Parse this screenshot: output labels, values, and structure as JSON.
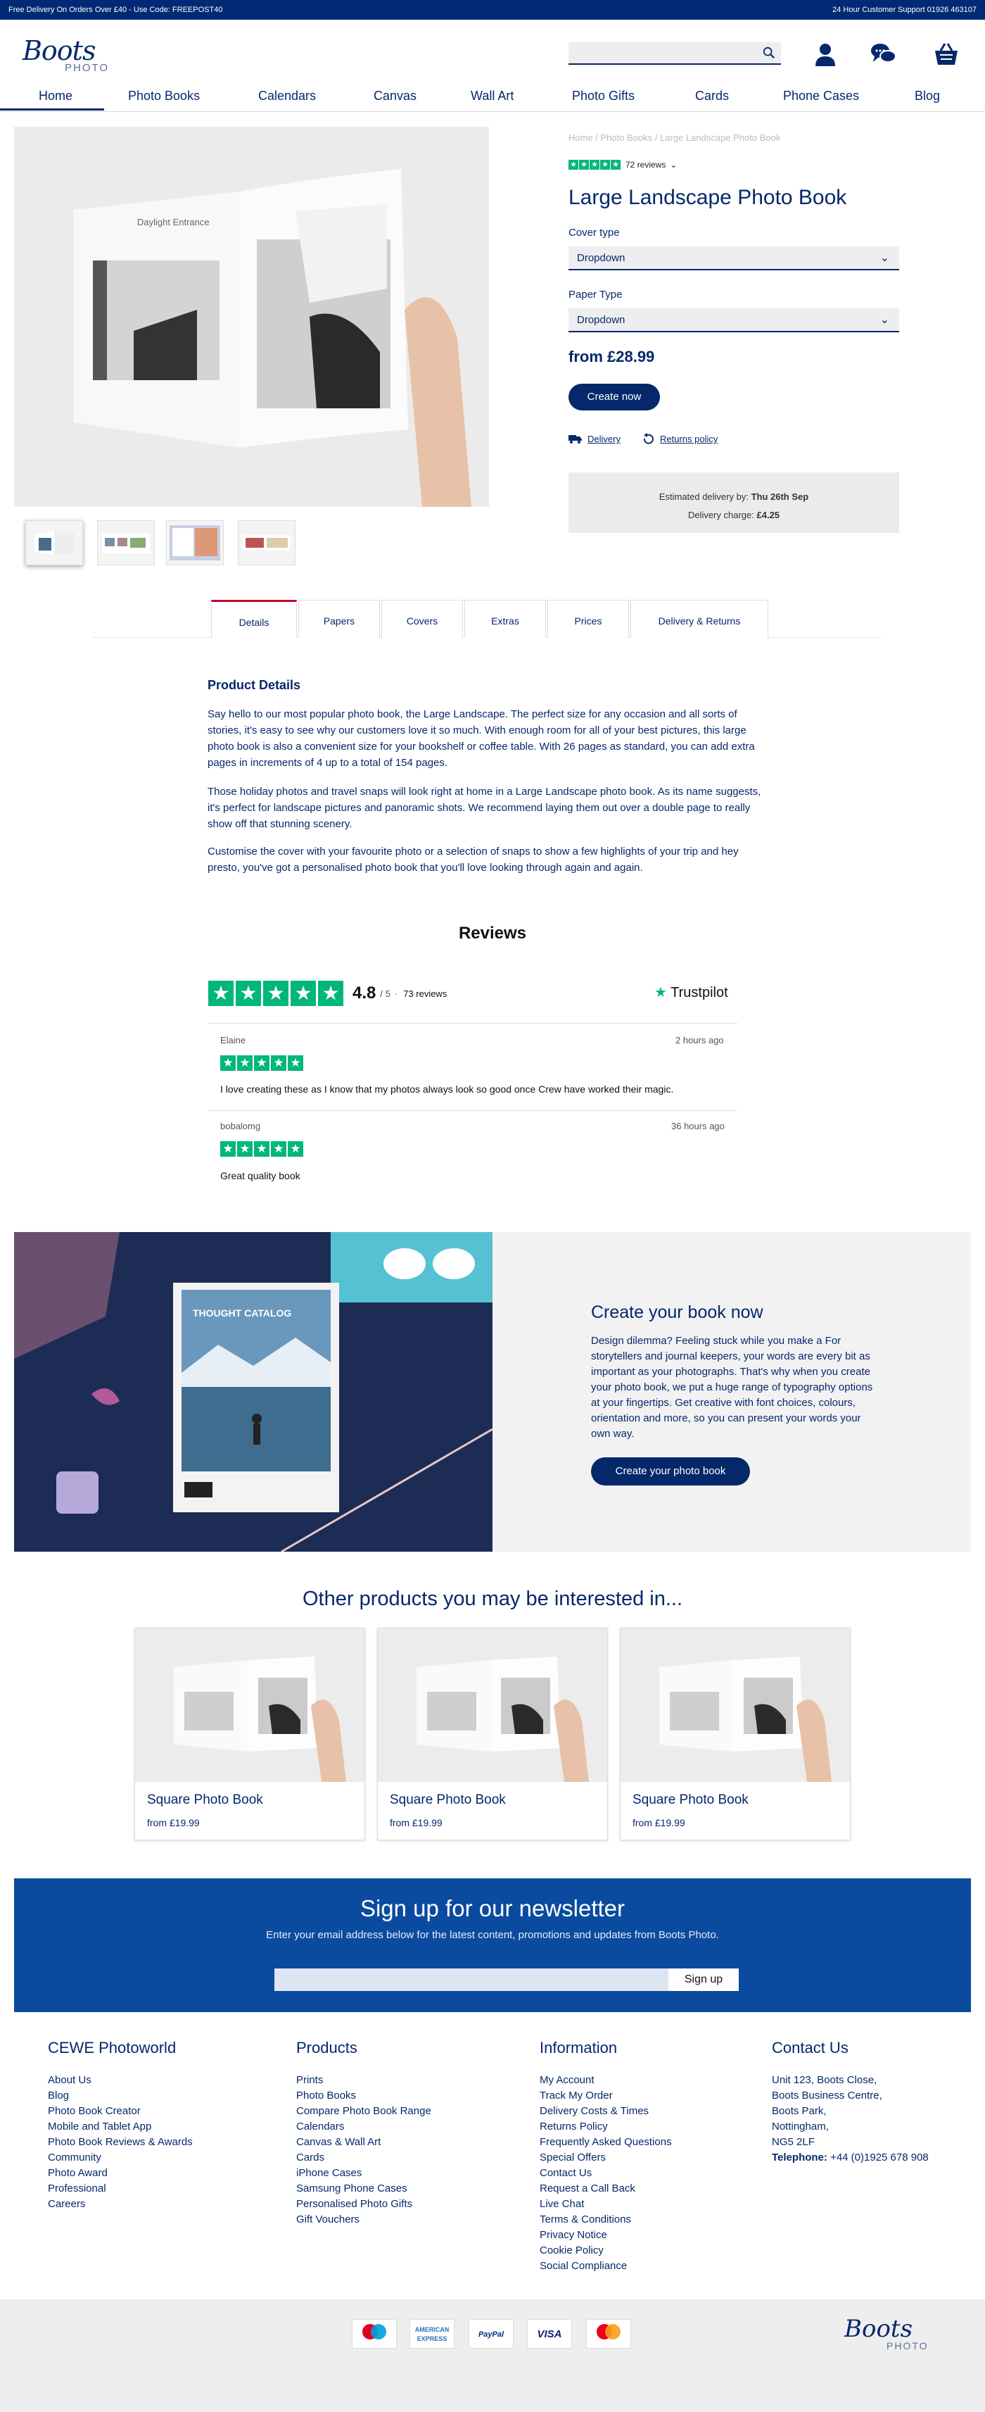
{
  "topbar": {
    "left": "Free Delivery On Orders Over £40 - Use Code: FREEPOST40",
    "right": "24 Hour Customer Support 01926 463107"
  },
  "brand": {
    "name": "Boots",
    "sub": "PHOTO"
  },
  "nav": [
    "Home",
    "Photo Books",
    "Calendars",
    "Canvas",
    "Wall Art",
    "Photo Gifts",
    "Cards",
    "Phone Cases",
    "Blog"
  ],
  "product": {
    "breadcrumb": "Home / Photo Books / Large Landscape Photo Book",
    "reviews_count": "72 reviews",
    "title": "Large Landscape Photo Book",
    "cover_label": "Cover type",
    "cover_value": "Dropdown",
    "paper_label": "Paper Type",
    "paper_value": "Dropdown",
    "price": "from £28.99",
    "cta": "Create now",
    "delivery_link": "Delivery",
    "returns_link": "Returns policy",
    "est_delivery_label": "Estimated delivery by:",
    "est_delivery_value": "Thu 26th Sep",
    "charge_label": "Delivery charge:",
    "charge_value": "£4.25",
    "book_caption": "Daylight Entrance"
  },
  "tabs": [
    "Details",
    "Papers",
    "Covers",
    "Extras",
    "Prices",
    "Delivery & Returns"
  ],
  "details": {
    "title": "Product Details",
    "p1": "Say hello to our most popular photo book, the Large Landscape. The perfect size for any occasion and all sorts of stories, it's easy to see why our customers love it so much. With enough room for all of your best pictures, this large photo book is also a convenient size for your bookshelf or coffee table. With 26 pages as standard, you can add extra pages in increments of 4 up to a total of 154 pages.",
    "p2": "Those holiday photos and travel snaps will look right at home in a Large Landscape photo book. As its name suggests, it's perfect for landscape pictures and panoramic shots. We recommend laying them out over a double page to really show off that stunning scenery.",
    "p3": "Customise the cover with your favourite photo or a selection of snaps to show a few highlights of your trip and hey presto, you've got a personalised photo book that you'll love looking through again and again."
  },
  "reviews": {
    "title": "Reviews",
    "score": "4.8",
    "out_of": "/ 5",
    "count": "73 reviews",
    "provider": "Trustpilot",
    "items": [
      {
        "name": "Elaine",
        "time": "2 hours ago",
        "text": "I love creating these as I know that my photos always look so good once Crew have worked their magic."
      },
      {
        "name": "bobalomg",
        "time": "36 hours ago",
        "text": "Great quality book"
      }
    ]
  },
  "promo": {
    "title": "Create your book now",
    "text": "Design dilemma? Feeling stuck while you make a For storytellers and journal keepers, your words are every bit as important as your photographs. That's why when you create your photo book, we put a huge range of typography options at your fingertips. Get creative with font choices, colours, orientation and more, so you can present your words your own way.",
    "cta": "Create your photo book",
    "catalog_title": "THOUGHT CATALOG"
  },
  "other": {
    "title": "Other products you may be interested in...",
    "items": [
      {
        "name": "Square Photo Book",
        "price": "from £19.99"
      },
      {
        "name": "Square Photo Book",
        "price": "from £19.99"
      },
      {
        "name": "Square Photo Book",
        "price": "from £19.99"
      }
    ]
  },
  "newsletter": {
    "title": "Sign up for our newsletter",
    "sub": "Enter your email address below for the latest content, promotions and updates from Boots Photo.",
    "cta": "Sign up"
  },
  "footer": {
    "cols": [
      {
        "title": "CEWE Photoworld",
        "links": [
          "About Us",
          "Blog",
          "Photo Book Creator",
          "Mobile and Tablet App",
          "Photo Book Reviews & Awards",
          "Community",
          "Photo Award",
          "Professional",
          "Careers"
        ]
      },
      {
        "title": "Products",
        "links": [
          "Prints",
          "Photo Books",
          "Compare Photo Book Range",
          "Calendars",
          "Canvas & Wall Art",
          "Cards",
          "iPhone Cases",
          "Samsung Phone Cases",
          "Personalised Photo Gifts",
          "Gift Vouchers"
        ]
      },
      {
        "title": "Information",
        "links": [
          "My Account",
          "Track My Order",
          "Delivery Costs & Times",
          "Returns Policy",
          "Frequently Asked Questions",
          "Special Offers",
          "Contact Us",
          "Request a Call Back",
          "Live Chat",
          "Terms & Conditions",
          "Privacy Notice",
          "Cookie Policy",
          "Social Compliance"
        ]
      },
      {
        "title": "Contact Us",
        "links": [
          "Unit 123, Boots Close,",
          "Boots Business Centre,",
          "Boots Park,",
          "Nottingham,",
          "NG5 2LF"
        ],
        "phone_label": "Telephone:",
        "phone": "+44 (0)1925 678 908"
      }
    ],
    "payments": [
      "Maestro",
      "AMERICAN EXPRESS",
      "PayPal",
      "VISA",
      "mastercard"
    ]
  },
  "colors": {
    "navy": "#05286b",
    "topbar": "#002a75",
    "trustpilot": "#00b67a",
    "newsletter": "#0a4ba0",
    "tab_accent": "#c3002f"
  }
}
